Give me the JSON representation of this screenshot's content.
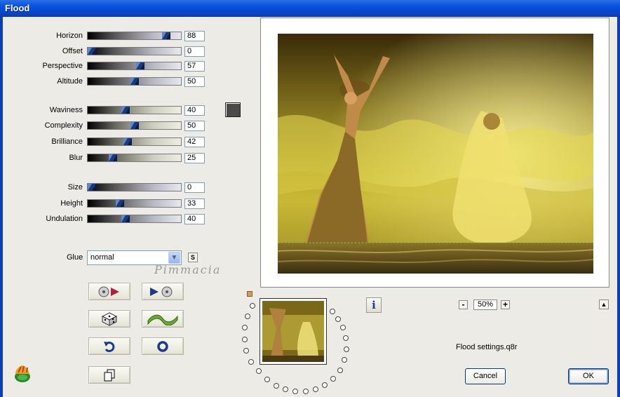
{
  "window": {
    "title": "Flood"
  },
  "params": [
    {
      "label": "Horizon",
      "value": "88",
      "level": 88,
      "track": "gray"
    },
    {
      "label": "Offset",
      "value": "0",
      "level": 0,
      "track": "gray"
    },
    {
      "label": "Perspective",
      "value": "57",
      "level": 57,
      "track": "gray"
    },
    {
      "label": "Altitude",
      "value": "50",
      "level": 50,
      "track": "gray"
    },
    {
      "label": "Waviness",
      "value": "40",
      "level": 40,
      "track": "beige"
    },
    {
      "label": "Complexity",
      "value": "50",
      "level": 50,
      "track": "beige"
    },
    {
      "label": "Brilliance",
      "value": "42",
      "level": 42,
      "track": "beige"
    },
    {
      "label": "Blur",
      "value": "25",
      "level": 25,
      "track": "beige"
    },
    {
      "label": "Size",
      "value": "0",
      "level": 0,
      "track": "gray"
    },
    {
      "label": "Height",
      "value": "33",
      "level": 33,
      "track": "gray"
    },
    {
      "label": "Undulation",
      "value": "40",
      "level": 40,
      "track": "gray"
    }
  ],
  "glue": {
    "label": "Glue",
    "value": "normal",
    "s_label": "S"
  },
  "watermark": "Pimmacia",
  "toolbar": {
    "buttons": [
      "load-preset-icon",
      "save-preset-icon",
      "randomize-dice-icon",
      "wave-icon",
      "undo-icon",
      "reset-icon",
      "copy-icon"
    ]
  },
  "zoom": {
    "value": "50%",
    "minus": "-",
    "plus": "+"
  },
  "info_label": "i",
  "collapse_label": "▲",
  "settings_file": "Flood settings.q8r",
  "buttons": {
    "cancel": "Cancel",
    "ok": "OK"
  },
  "colors": {
    "title_bar": "#0a55de",
    "swatch": "#4a4a4a",
    "background": "#ecebe6"
  }
}
